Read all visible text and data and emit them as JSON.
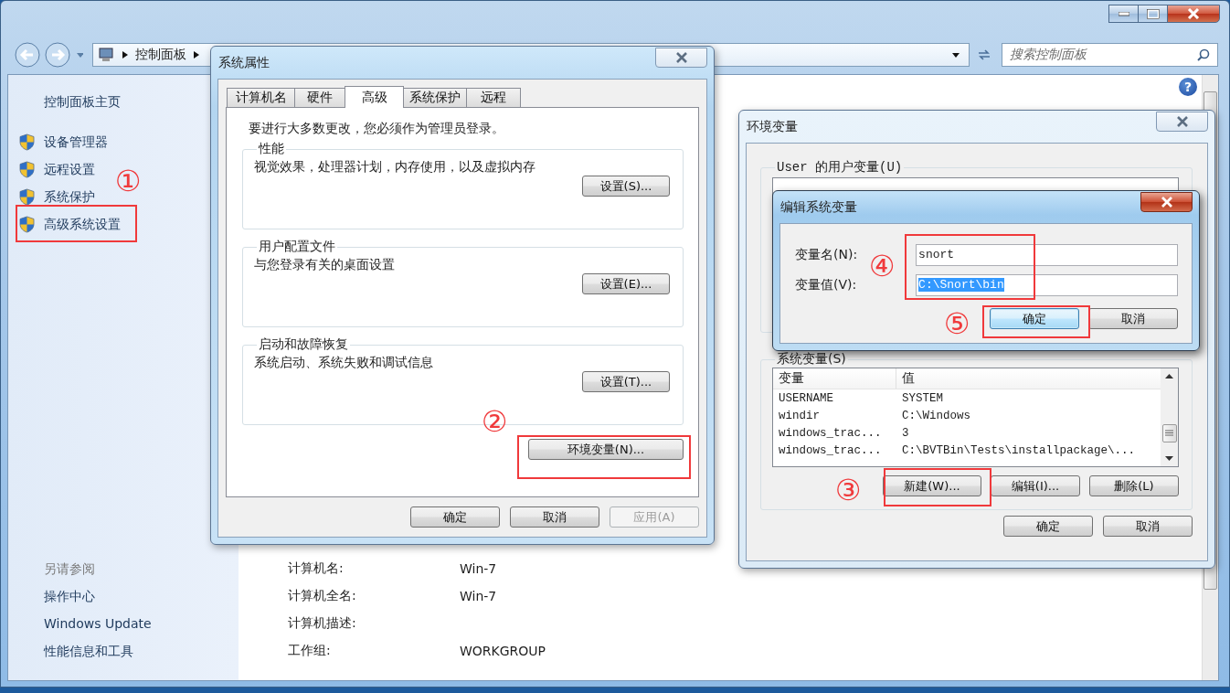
{
  "window": {
    "breadcrumb": [
      "控制面板"
    ],
    "search_placeholder": "搜索控制面板",
    "help": "?"
  },
  "sidebar": {
    "home": "控制面板主页",
    "tasks": [
      "设备管理器",
      "远程设置",
      "系统保护",
      "高级系统设置"
    ],
    "see_also_title": "另请参阅",
    "see_also": [
      "操作中心",
      "Windows Update",
      "性能信息和工具"
    ]
  },
  "computer_info": [
    {
      "label": "计算机名:",
      "value": "Win-7"
    },
    {
      "label": "计算机全名:",
      "value": "Win-7"
    },
    {
      "label": "计算机描述:"
    },
    {
      "label": "工作组:",
      "value": "WORKGROUP"
    }
  ],
  "system_properties": {
    "title": "系统属性",
    "tabs": [
      {
        "label": "计算机名",
        "selected": false
      },
      {
        "label": "硬件",
        "selected": false
      },
      {
        "label": "高级",
        "selected": true
      },
      {
        "label": "系统保护",
        "selected": false
      },
      {
        "label": "远程",
        "selected": false
      }
    ],
    "notice": "要进行大多数更改，您必须作为管理员登录。",
    "groups": [
      {
        "title": "性能",
        "description": "视觉效果，处理器计划，内存使用，以及虚拟内存",
        "button": "设置(S)..."
      },
      {
        "title": "用户配置文件",
        "description": "与您登录有关的桌面设置",
        "button": "设置(E)..."
      },
      {
        "title": "启动和故障恢复",
        "description": "系统启动、系统失败和调试信息",
        "button": "设置(T)..."
      }
    ],
    "env_button": "环境变量(N)...",
    "buttons": [
      {
        "label": "确定",
        "disabled": false
      },
      {
        "label": "取消",
        "disabled": false
      },
      {
        "label": "应用(A)",
        "disabled": true
      }
    ]
  },
  "environment_variables": {
    "title": "环境变量",
    "user_group": "User 的用户变量(U)",
    "system_group": "系统变量(S)",
    "columns": [
      "变量",
      "值"
    ],
    "rows": [
      [
        "USERNAME",
        "SYSTEM"
      ],
      [
        "windir",
        "C:\\Windows"
      ],
      [
        "windows_trac...",
        "3"
      ],
      [
        "windows_trac...",
        "C:\\BVTBin\\Tests\\installpackage\\..."
      ]
    ],
    "list_buttons": [
      "新建(W)...",
      "编辑(I)...",
      "删除(L)"
    ],
    "buttons": [
      "确定",
      "取消"
    ]
  },
  "edit_variable": {
    "title": "编辑系统变量",
    "fields": [
      {
        "label": "变量名(N):",
        "value": "snort",
        "selected": false
      },
      {
        "label": "变量值(V):",
        "value": "C:\\Snort\\bin",
        "selected": true
      }
    ],
    "buttons": [
      {
        "label": "确定",
        "default": true
      },
      {
        "label": "取消",
        "default": false
      }
    ]
  },
  "annotations": [
    "①",
    "②",
    "③",
    "④",
    "⑤"
  ]
}
